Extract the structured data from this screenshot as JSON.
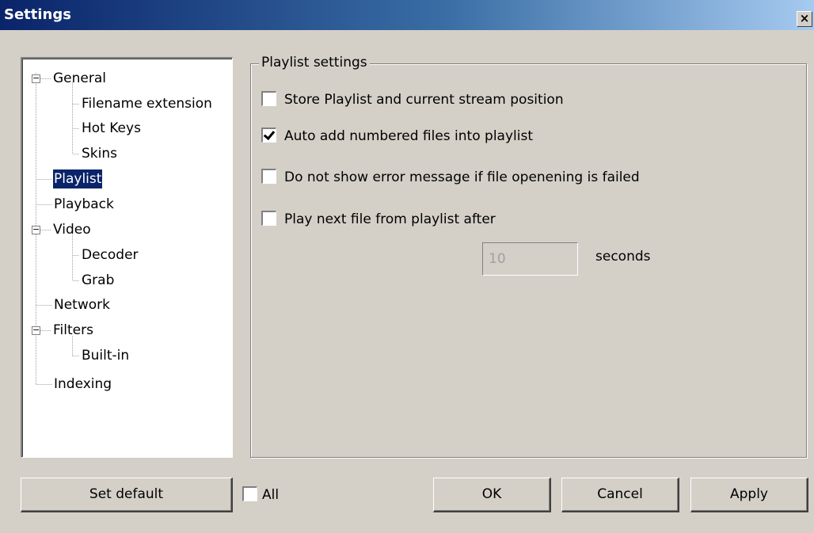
{
  "window": {
    "title": "Settings",
    "close_label": "×"
  },
  "tree": {
    "items": [
      {
        "label": "General",
        "expander": "−"
      },
      {
        "label": "Filename extension"
      },
      {
        "label": "Hot Keys"
      },
      {
        "label": "Skins"
      },
      {
        "label": "Playlist",
        "selected": true
      },
      {
        "label": "Playback"
      },
      {
        "label": "Video",
        "expander": "−"
      },
      {
        "label": "Decoder"
      },
      {
        "label": "Grab"
      },
      {
        "label": "Network"
      },
      {
        "label": "Filters",
        "expander": "−"
      },
      {
        "label": "Built-in"
      },
      {
        "label": "Indexing"
      }
    ]
  },
  "playlist_settings": {
    "group_label": "Playlist settings",
    "options": [
      {
        "label": "Store Playlist and current stream position",
        "checked": false
      },
      {
        "label": "Auto add numbered files into playlist",
        "checked": true
      },
      {
        "label": "Do not show error message if file openening is failed",
        "checked": false
      },
      {
        "label": "Play next file from playlist after",
        "checked": false
      }
    ],
    "seconds_value": "10",
    "seconds_label": "seconds"
  },
  "footer": {
    "set_default_label": "Set default",
    "all_label": "All",
    "all_checked": false,
    "ok_label": "OK",
    "cancel_label": "Cancel",
    "apply_label": "Apply"
  },
  "colors": {
    "title_gradient_start": "#0a246a",
    "title_gradient_end": "#a6caf0",
    "selection": "#0a246a",
    "dialog_bg": "#d4d0c8"
  }
}
